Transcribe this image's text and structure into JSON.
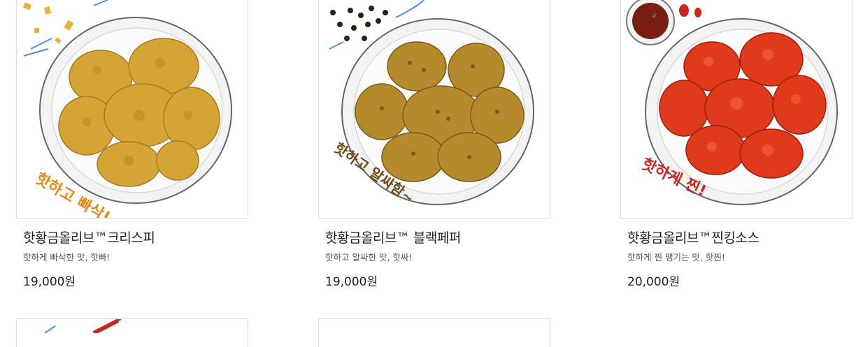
{
  "products": [
    {
      "name": "핫황금올리브™크리스피",
      "description": "핫하게 빠삭한 맛, 핫빠!",
      "price": "19,000원",
      "slogan": "핫하고 빠삭!",
      "image_icon": "fried-chicken-crispy-icon",
      "sauce_color": "#e0871a"
    },
    {
      "name": "핫황금올리브™ 블랙페퍼",
      "description": "핫하고 알싸한 맛, 핫싸!",
      "price": "19,000원",
      "slogan": "핫하고 알싸함~",
      "image_icon": "fried-chicken-blackpepper-icon",
      "sauce_color": "#6b4a1c"
    },
    {
      "name": "핫황금올리브™찐킹소스",
      "description": "핫하게 찐 땡기는 맛, 핫찐!",
      "price": "20,000원",
      "slogan": "핫하게 찐!",
      "image_icon": "fried-chicken-sauce-icon",
      "sauce_color": "#c8281f"
    }
  ],
  "next_row_images": [
    "chili-pepper-icon",
    "product-image"
  ]
}
